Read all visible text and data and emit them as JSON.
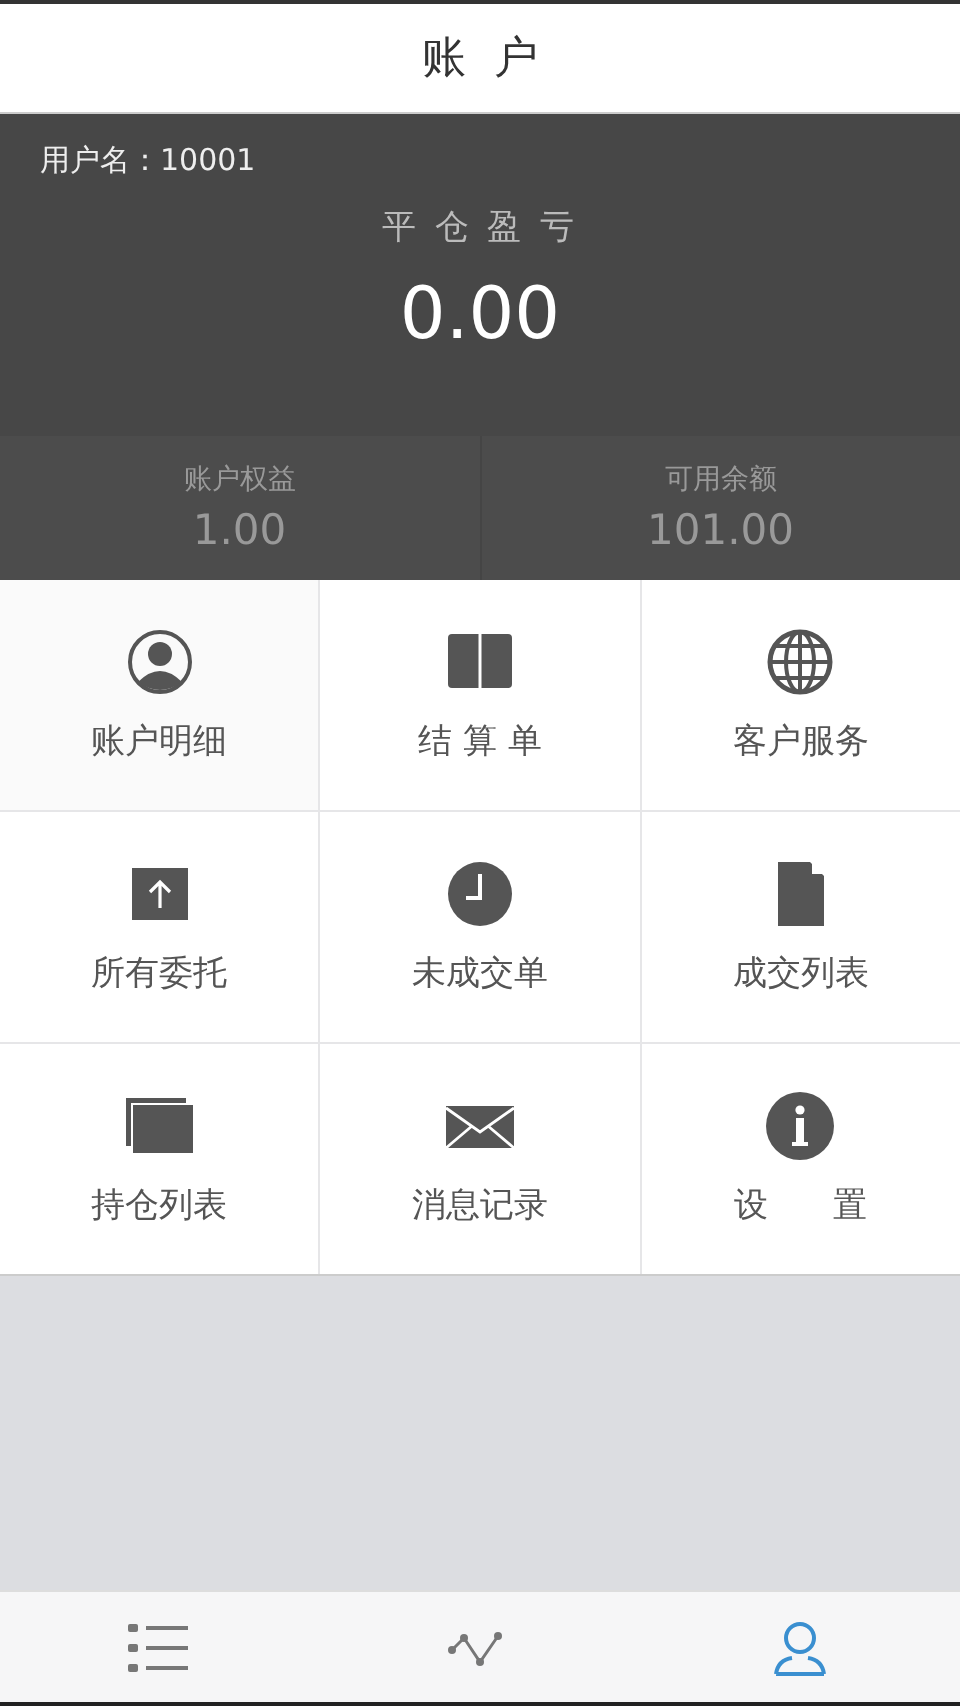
{
  "header": {
    "title": "账  户"
  },
  "summary": {
    "username_label": "用户名：",
    "username": "10001",
    "pnl_label": "平 仓 盈 亏",
    "pnl": "0.00",
    "stats": [
      {
        "label": "账户权益",
        "value": "1.00"
      },
      {
        "label": "可用余额",
        "value": "101.00"
      }
    ]
  },
  "menu": [
    {
      "label": "账户明细"
    },
    {
      "label": "结 算 单"
    },
    {
      "label": "客户服务"
    },
    {
      "label": "所有委托"
    },
    {
      "label": "未成交单"
    },
    {
      "label": "成交列表"
    },
    {
      "label": "持仓列表"
    },
    {
      "label": "消息记录"
    },
    {
      "label": "设      置"
    }
  ],
  "tab_bar": [
    {
      "selected": false
    },
    {
      "selected": false
    },
    {
      "selected": true
    }
  ]
}
